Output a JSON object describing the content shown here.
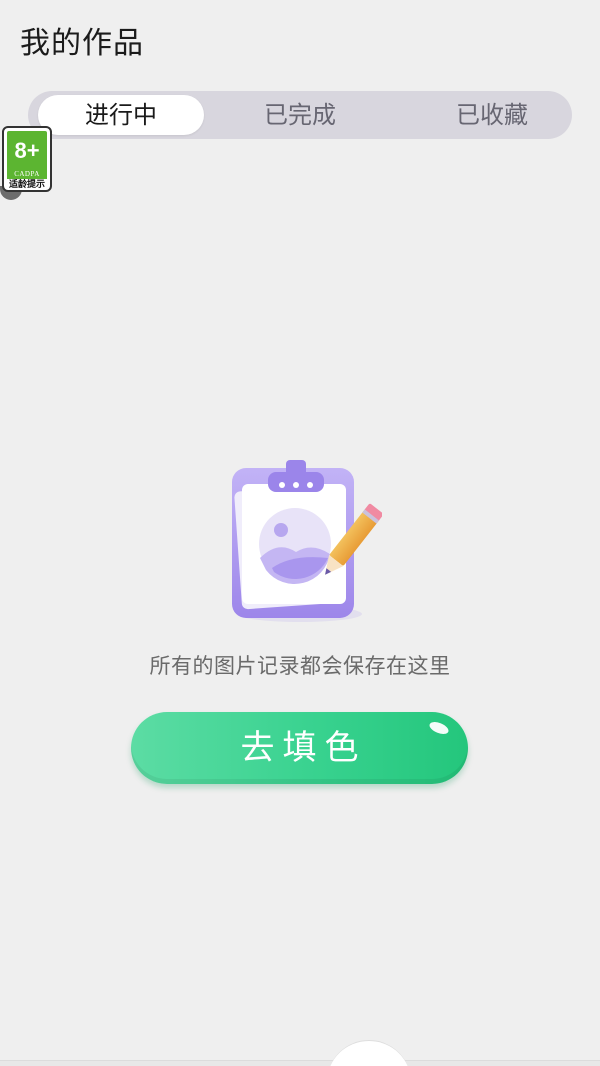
{
  "header": {
    "title": "我的作品"
  },
  "tabs": [
    {
      "label": "进行中",
      "active": true
    },
    {
      "label": "已完成",
      "active": false
    },
    {
      "label": "已收藏",
      "active": false
    }
  ],
  "age_badge": {
    "rating": "8+",
    "org": "CADPA",
    "caption": "适龄提示",
    "color": "#5cb531"
  },
  "empty_state": {
    "icon": "clipboard-image-pencil-icon",
    "message": "所有的图片记录都会保存在这里"
  },
  "cta": {
    "label": "去填色",
    "color": "#38d28f"
  },
  "colors": {
    "background": "#efefef",
    "tab_track": "#d8d6de",
    "accent_purple": "#a894ee"
  }
}
